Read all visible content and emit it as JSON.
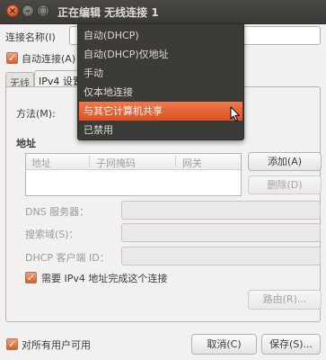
{
  "window": {
    "title": "正在编辑 无线连接 1",
    "close_glyph": "×",
    "min_glyph": "–",
    "max_glyph": "□"
  },
  "connection": {
    "name_label": "连接名称(I)",
    "auto_connect_label": "自动连接(A)",
    "auto_connect_checked": true
  },
  "tabs": [
    {
      "label": "无线",
      "active": false
    },
    {
      "label": "IPv4 设置",
      "active": true
    }
  ],
  "ipv4": {
    "method_label": "方法(M):",
    "address_section_label": "地址",
    "table_headers": [
      "地址",
      "子网掩码",
      "网关"
    ],
    "add_button": "添加(A)",
    "delete_button": "删除(D)",
    "dns_label": "DNS 服务器：",
    "search_domain_label": "搜索域(S)：",
    "dhcp_client_id_label": "DHCP 客户端 ID：",
    "require_ipv4_label": "需要 IPv4 地址完成这个连接",
    "require_ipv4_checked": true,
    "routes_button": "路由(R)..."
  },
  "method_menu": {
    "options": [
      "自动(DHCP)",
      "自动(DHCP)仅地址",
      "手动",
      "仅本地连接",
      "与其它计算机共享",
      "已禁用"
    ],
    "highlighted_index": 4
  },
  "footer": {
    "all_users_label": "对所有用户可用",
    "all_users_checked": true,
    "cancel_button": "取消(C)",
    "save_button": "保存(S)..."
  },
  "colors": {
    "accent": "#e2592b",
    "titlebar": "#3c3b37",
    "menu_bg": "#3c3b37",
    "window_bg": "#f2f1f0"
  }
}
